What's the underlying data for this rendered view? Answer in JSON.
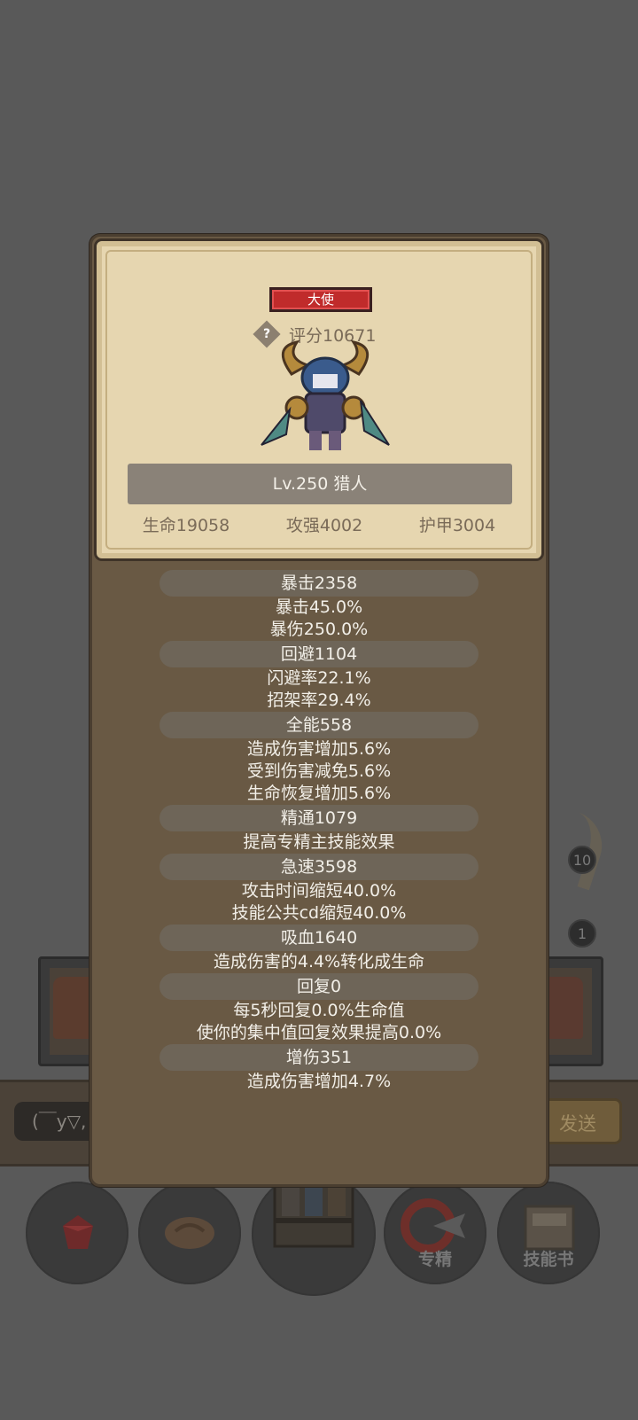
{
  "background": {
    "badges": [
      "10",
      "1"
    ],
    "chat": {
      "input_text": "(￣y▽,",
      "send_label": "发送"
    },
    "nav": [
      {
        "name": "gem",
        "label": ""
      },
      {
        "name": "bread",
        "label": ""
      },
      {
        "name": "chest",
        "label": "",
        "badge": "!"
      },
      {
        "name": "specialize",
        "label": "专精"
      },
      {
        "name": "skill-book",
        "label": "技能书"
      }
    ]
  },
  "hero": {
    "title_badge": "大使",
    "score": "评分10671",
    "level_name": "Lv.250 猎人",
    "stats": {
      "hp": "生命19058",
      "attack": "攻强4002",
      "armor": "护甲3004"
    }
  },
  "stat_groups": [
    {
      "header": "暴击2358",
      "lines": [
        "暴击45.0%",
        "暴伤250.0%"
      ]
    },
    {
      "header": "回避1104",
      "lines": [
        "闪避率22.1%",
        "招架率29.4%"
      ]
    },
    {
      "header": "全能558",
      "lines": [
        "造成伤害增加5.6%",
        "受到伤害减免5.6%",
        "生命恢复增加5.6%"
      ]
    },
    {
      "header": "精通1079",
      "lines": [
        "提高专精主技能效果"
      ]
    },
    {
      "header": "急速3598",
      "lines": [
        "攻击时间缩短40.0%",
        "技能公共cd缩短40.0%"
      ]
    },
    {
      "header": "吸血1640",
      "lines": [
        "造成伤害的4.4%转化成生命"
      ]
    },
    {
      "header": "回复0",
      "lines": [
        "每5秒回复0.0%生命值",
        "使你的集中值回复效果提高0.0%"
      ]
    },
    {
      "header": "增伤351",
      "lines": [
        "造成伤害增加4.7%"
      ]
    }
  ],
  "colors": {
    "accent_red": "#c02b2b",
    "panel": "#695944",
    "parchment": "#e6d6b0"
  }
}
